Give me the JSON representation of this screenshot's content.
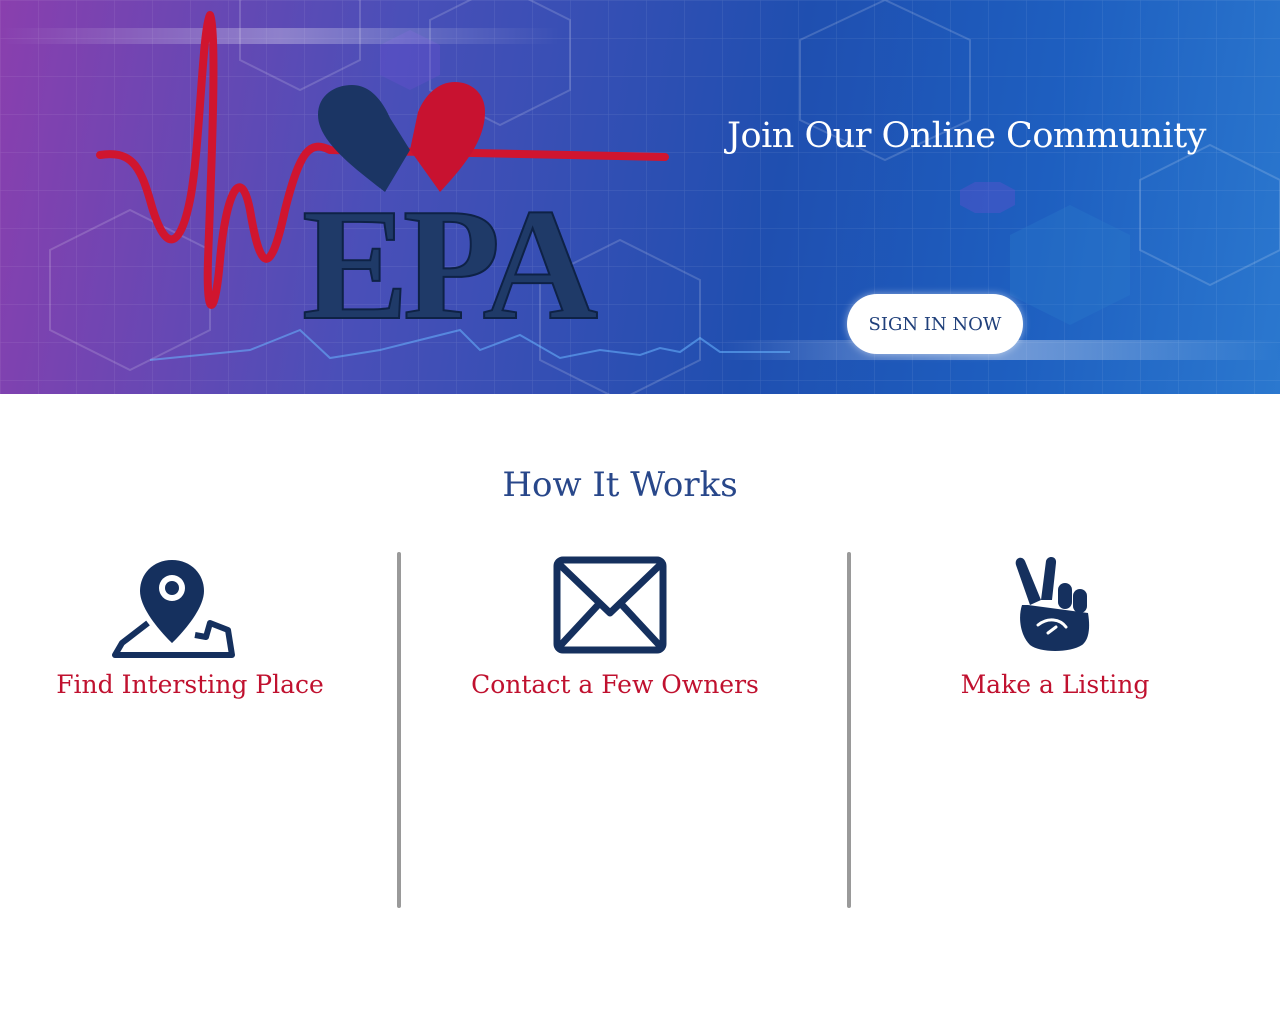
{
  "hero": {
    "logo_text": "EPA",
    "title": "Join Our Online Community",
    "signin_label": "SIGN IN NOW"
  },
  "how_it_works": {
    "title": "How It Works",
    "steps": [
      {
        "label": "Find Intersting Place",
        "icon": "map-pin-icon"
      },
      {
        "label": "Contact a Few Owners",
        "icon": "envelope-icon"
      },
      {
        "label": "Make a Listing",
        "icon": "peace-hand-icon"
      }
    ]
  },
  "colors": {
    "brand_navy": "#1b3564",
    "brand_red": "#c0112f",
    "title_blue": "#28478a"
  }
}
